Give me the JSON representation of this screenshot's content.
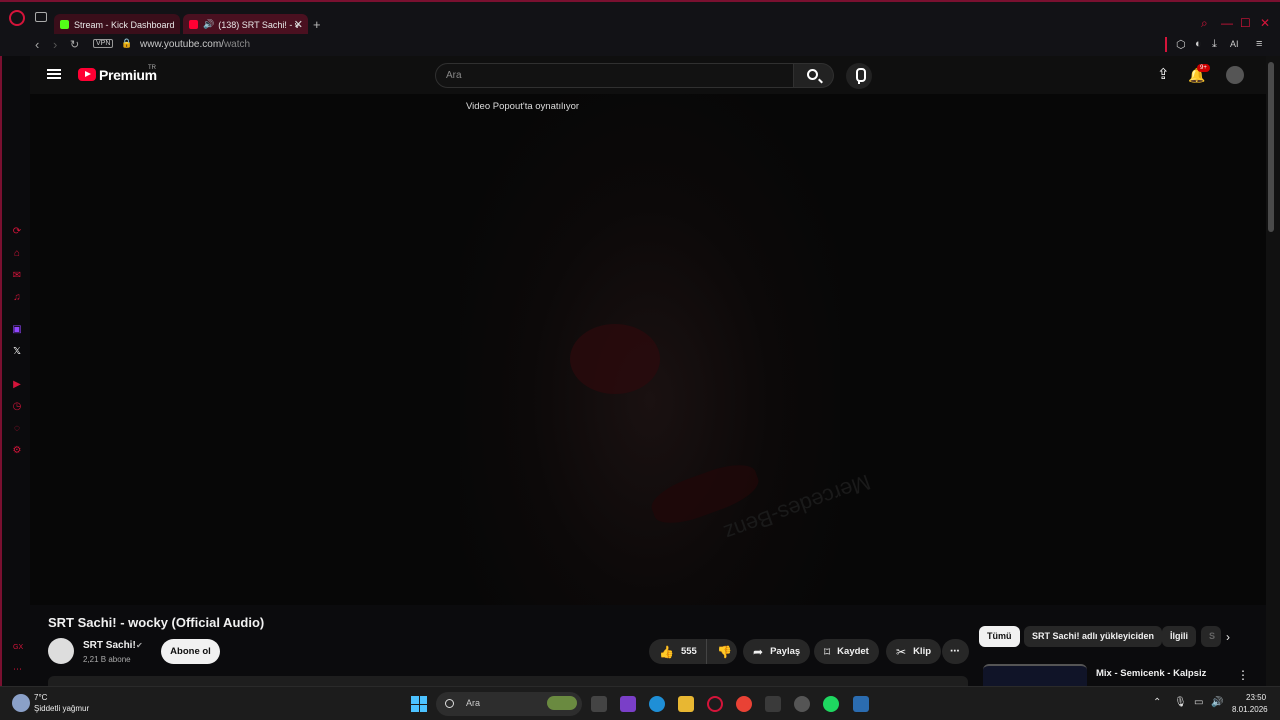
{
  "browser": {
    "tabs": [
      {
        "label": "Stream - Kick Dashboard"
      },
      {
        "label": "(138) SRT Sachi! - v"
      }
    ],
    "url_domain": "www.youtube.com/",
    "url_path": "watch",
    "vpn_label": "VPN",
    "ai_label": "AI"
  },
  "youtube": {
    "brand": "Premium",
    "country": "TR",
    "search_placeholder": "Ara",
    "notification_count": "9+",
    "popout_message": "Video Popout'ta oynatılıyor",
    "watermark": "Mercedes-Benz",
    "video_title": "SRT Sachi! - wocky (Official Audio)",
    "channel_name": "SRT Sachi!",
    "channel_subs": "2,21 B abone",
    "subscribe_label": "Abone ol",
    "like_count": "555",
    "share_label": "Paylaş",
    "save_label": "Kaydet",
    "clip_label": "Klip",
    "chips": [
      "Tümü",
      "SRT Sachi! adlı yükleyiciden",
      "İlgili",
      "S"
    ],
    "recommendation_title": "Mix - Semicenk - Kalpsiz"
  },
  "sidebar_bottom_label": "GX",
  "taskbar": {
    "weather_temp": "7°C",
    "weather_desc": "Şiddetli yağmur",
    "search_label": "Ara",
    "time": "23:50",
    "date": "8.01.2026"
  },
  "colors": {
    "opera_accent": "#d4143a",
    "youtube_red": "#ff0033",
    "kick_green": "#53fc18"
  }
}
